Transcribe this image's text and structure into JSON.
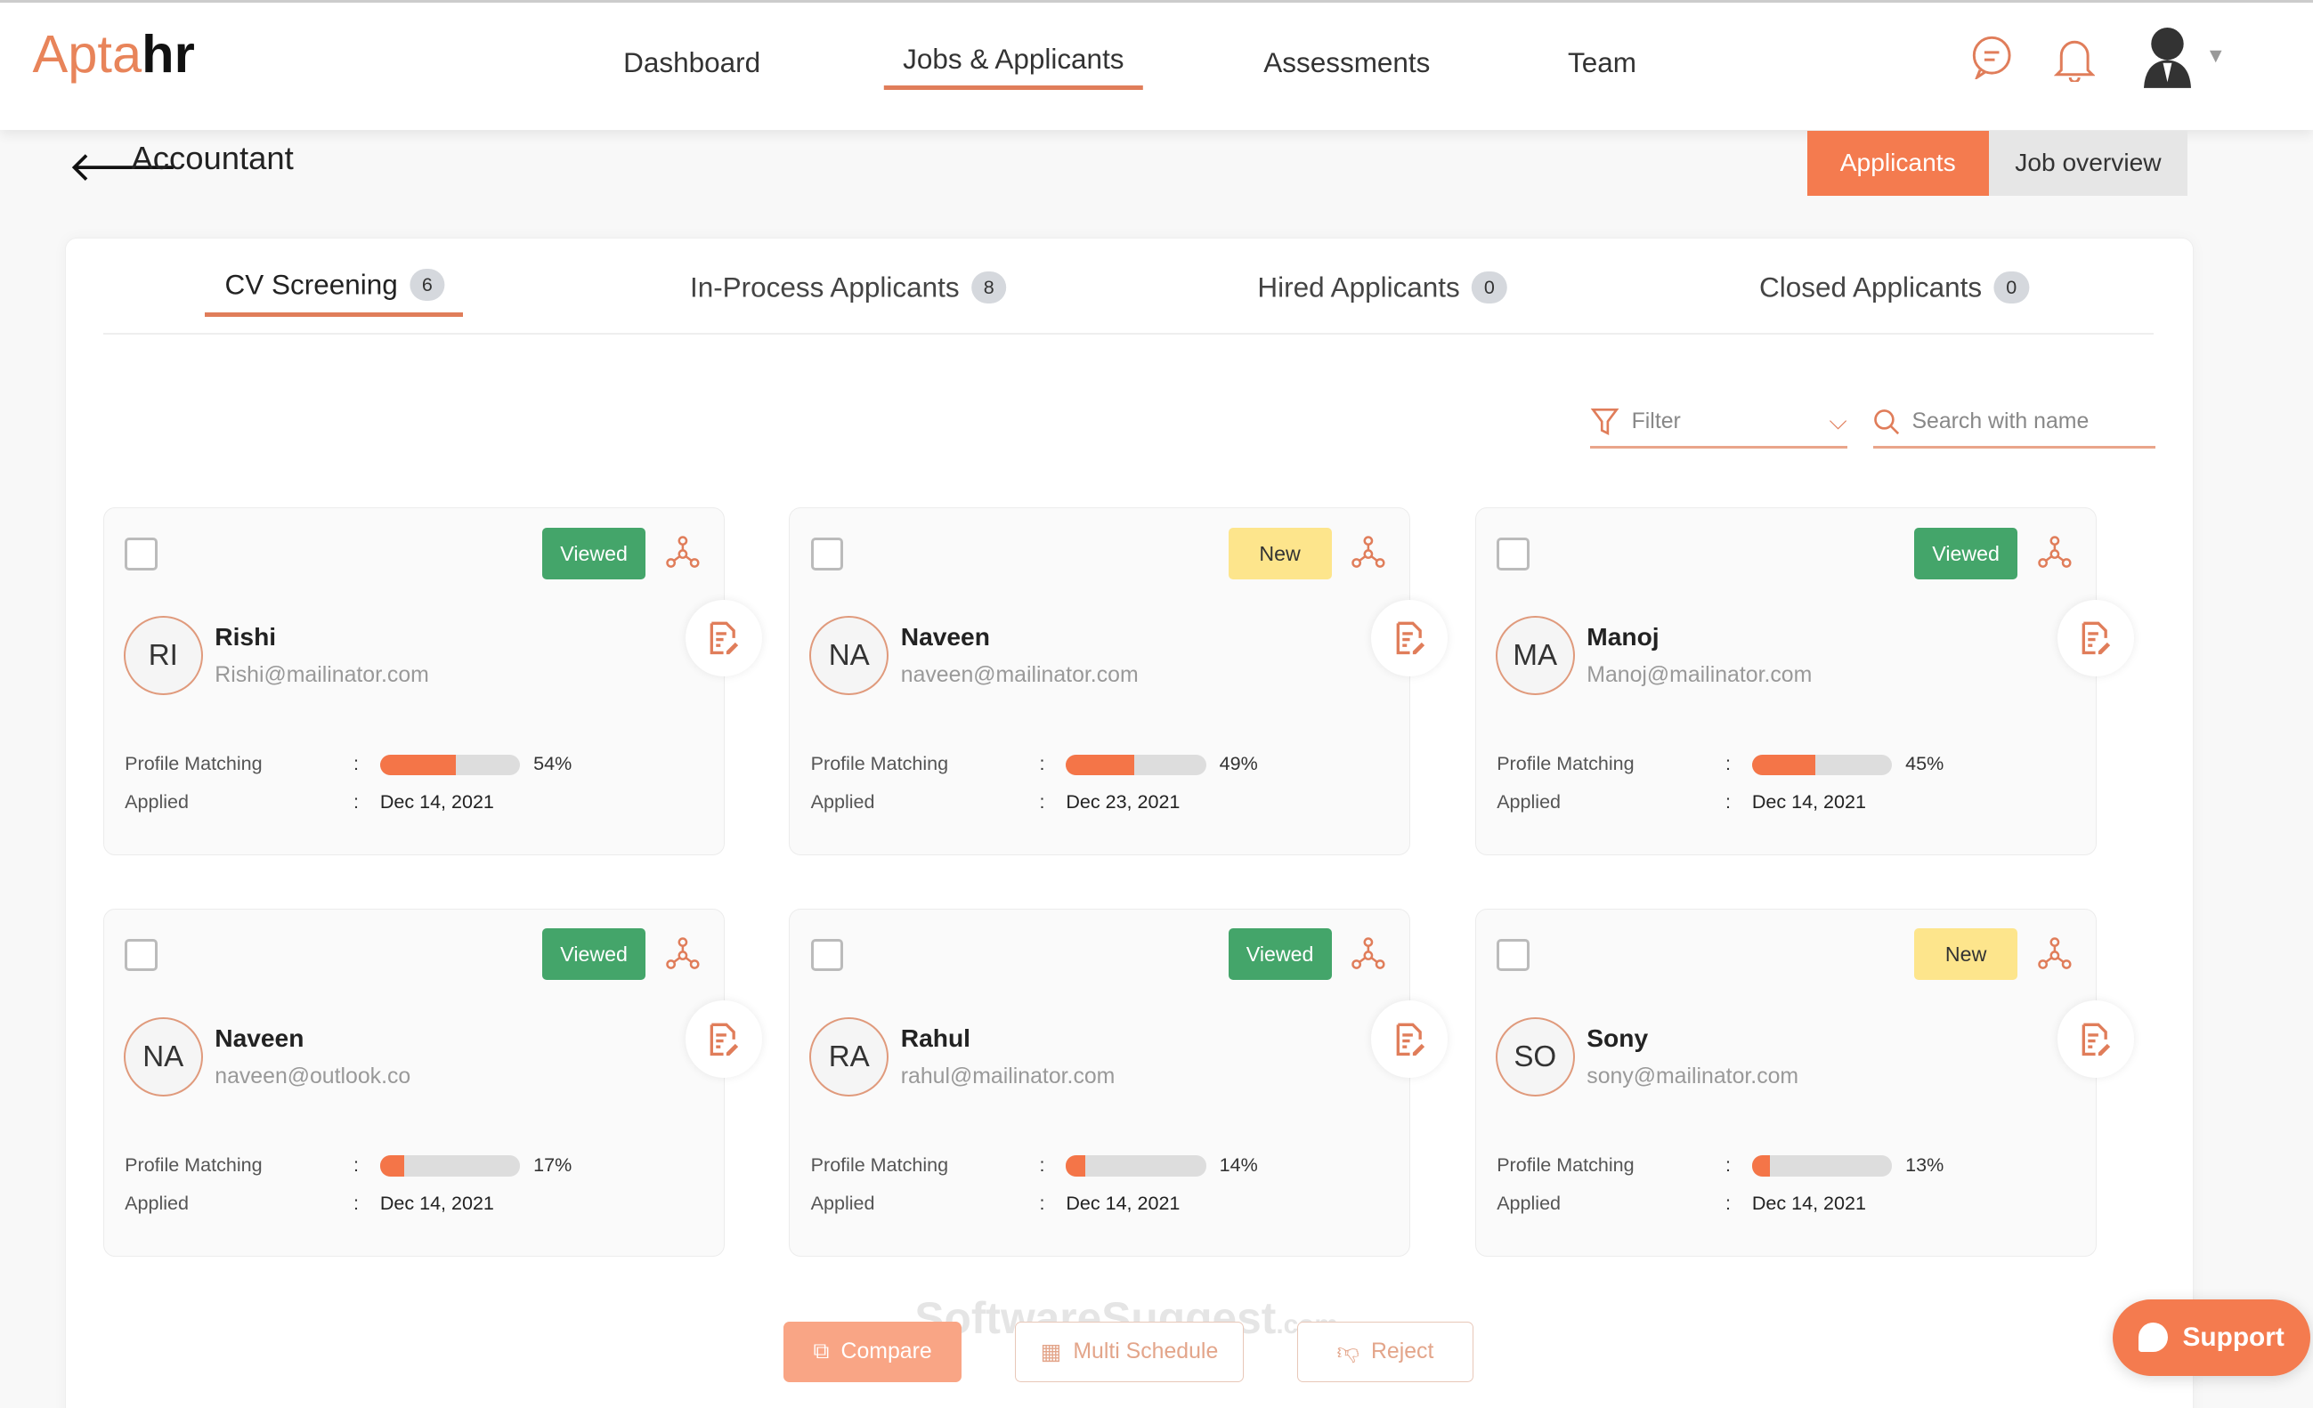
{
  "header": {
    "logo": "Aptahr",
    "logo_a": "Apta",
    "logo_b": "hr",
    "nav": [
      {
        "label": "Dashboard"
      },
      {
        "label": "Jobs & Applicants",
        "active": true
      },
      {
        "label": "Assessments"
      },
      {
        "label": "Team"
      }
    ]
  },
  "page": {
    "title": "Accountant",
    "toggle": {
      "applicants": "Applicants",
      "job_overview": "Job overview"
    }
  },
  "tabs": [
    {
      "label": "CV Screening",
      "count": "6"
    },
    {
      "label": "In-Process Applicants",
      "count": "8"
    },
    {
      "label": "Hired Applicants",
      "count": "0"
    },
    {
      "label": "Closed Applicants",
      "count": "0"
    }
  ],
  "filter": {
    "label": "Filter"
  },
  "search": {
    "placeholder": "Search with name"
  },
  "field_labels": {
    "profile": "Profile Matching",
    "applied": "Applied",
    "colon": ":"
  },
  "applicants": [
    {
      "initials": "RI",
      "name": "Rishi",
      "email": "Rishi@mailinator.com",
      "status": "Viewed",
      "match": 54,
      "match_label": "54%",
      "applied": "Dec 14, 2021"
    },
    {
      "initials": "NA",
      "name": "Naveen",
      "email": "naveen@mailinator.com",
      "status": "New",
      "match": 49,
      "match_label": "49%",
      "applied": "Dec 23, 2021"
    },
    {
      "initials": "MA",
      "name": "Manoj",
      "email": "Manoj@mailinator.com",
      "status": "Viewed",
      "match": 45,
      "match_label": "45%",
      "applied": "Dec 14, 2021"
    },
    {
      "initials": "NA",
      "name": "Naveen",
      "email": "naveen@outlook.co",
      "status": "Viewed",
      "match": 17,
      "match_label": "17%",
      "applied": "Dec 14, 2021"
    },
    {
      "initials": "RA",
      "name": "Rahul",
      "email": "rahul@mailinator.com",
      "status": "Viewed",
      "match": 14,
      "match_label": "14%",
      "applied": "Dec 14, 2021"
    },
    {
      "initials": "SO",
      "name": "Sony",
      "email": "sony@mailinator.com",
      "status": "New",
      "match": 13,
      "match_label": "13%",
      "applied": "Dec 14, 2021"
    }
  ],
  "actions": {
    "compare": "Compare",
    "multi_schedule": "Multi Schedule",
    "reject": "Reject"
  },
  "watermark": "SoftwareSuggest.com",
  "support": "Support",
  "colors": {
    "accent": "#f47b4f",
    "viewed": "#44a56a",
    "new": "#fde58c"
  }
}
